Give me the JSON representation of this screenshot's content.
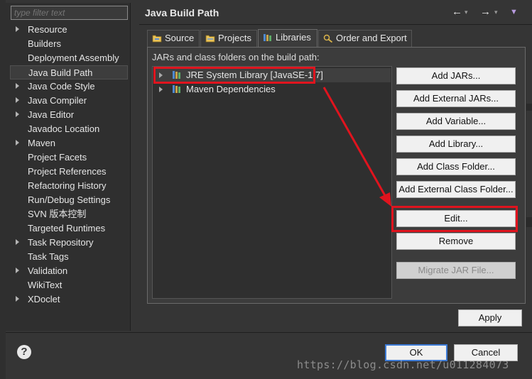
{
  "filter": {
    "placeholder": "type filter text"
  },
  "nav": {
    "items": [
      {
        "label": "Resource",
        "expandable": true,
        "selected": false
      },
      {
        "label": "Builders",
        "expandable": false,
        "selected": false
      },
      {
        "label": "Deployment Assembly",
        "expandable": false,
        "selected": false
      },
      {
        "label": "Java Build Path",
        "expandable": false,
        "selected": true
      },
      {
        "label": "Java Code Style",
        "expandable": true,
        "selected": false
      },
      {
        "label": "Java Compiler",
        "expandable": true,
        "selected": false
      },
      {
        "label": "Java Editor",
        "expandable": true,
        "selected": false
      },
      {
        "label": "Javadoc Location",
        "expandable": false,
        "selected": false
      },
      {
        "label": "Maven",
        "expandable": true,
        "selected": false
      },
      {
        "label": "Project Facets",
        "expandable": false,
        "selected": false
      },
      {
        "label": "Project References",
        "expandable": false,
        "selected": false
      },
      {
        "label": "Refactoring History",
        "expandable": false,
        "selected": false
      },
      {
        "label": "Run/Debug Settings",
        "expandable": false,
        "selected": false
      },
      {
        "label": "SVN 版本控制",
        "expandable": false,
        "selected": false
      },
      {
        "label": "Targeted Runtimes",
        "expandable": false,
        "selected": false
      },
      {
        "label": "Task Repository",
        "expandable": true,
        "selected": false
      },
      {
        "label": "Task Tags",
        "expandable": false,
        "selected": false
      },
      {
        "label": "Validation",
        "expandable": true,
        "selected": false
      },
      {
        "label": "WikiText",
        "expandable": false,
        "selected": false
      },
      {
        "label": "XDoclet",
        "expandable": true,
        "selected": false
      }
    ]
  },
  "header": {
    "title": "Java Build Path"
  },
  "tabs": [
    {
      "label": "Source",
      "icon": "source-folder-icon"
    },
    {
      "label": "Projects",
      "icon": "projects-folder-icon"
    },
    {
      "label": "Libraries",
      "icon": "libraries-icon",
      "active": true
    },
    {
      "label": "Order and Export",
      "icon": "order-export-icon"
    }
  ],
  "libraries": {
    "label": "JARs and class folders on the build path:",
    "entries": [
      {
        "label": "JRE System Library [JavaSE-1.7]",
        "selected": true
      },
      {
        "label": "Maven Dependencies",
        "selected": false
      }
    ]
  },
  "buttons": {
    "add_jars": "Add JARs...",
    "add_external_jars": "Add External JARs...",
    "add_variable": "Add Variable...",
    "add_library": "Add Library...",
    "add_class_folder": "Add Class Folder...",
    "add_external_class_folder": "Add External Class Folder...",
    "edit": "Edit...",
    "remove": "Remove",
    "migrate_jar": "Migrate JAR File...",
    "apply": "Apply",
    "ok": "OK",
    "cancel": "Cancel"
  },
  "watermark": "https://blog.csdn.net/u011284073",
  "colors": {
    "annotation": "#e0141e",
    "default_button_border": "#3d7bd6"
  }
}
